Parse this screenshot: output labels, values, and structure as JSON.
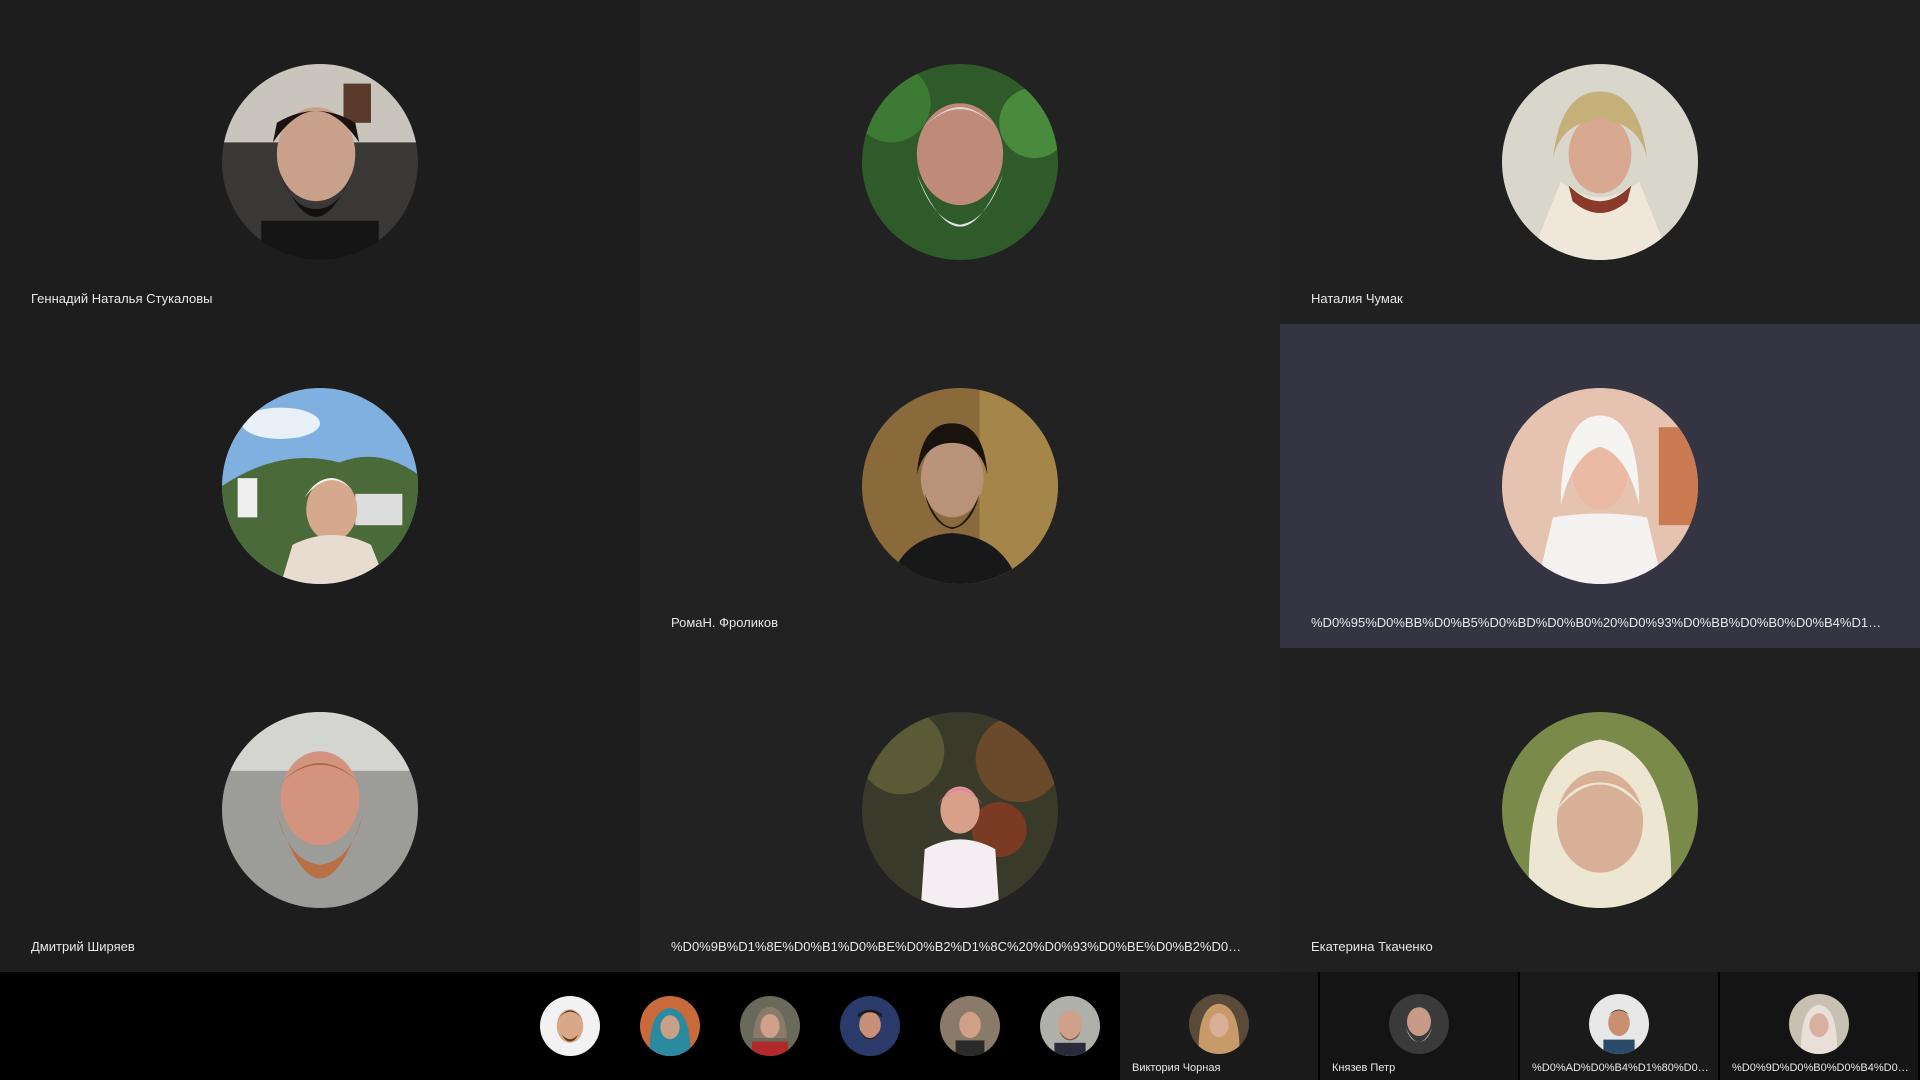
{
  "participants": [
    {
      "name": "Геннадий Наталья Стукаловы",
      "avatar": "avatar-man-bearded-dark"
    },
    {
      "name": "",
      "avatar": "avatar-man-white-beard"
    },
    {
      "name": "Наталия Чумак",
      "avatar": "avatar-woman-headscarf"
    },
    {
      "name": "",
      "avatar": "avatar-woman-outdoor"
    },
    {
      "name": "РомаН. Фроликов",
      "avatar": "avatar-man-dark-beard"
    },
    {
      "name": "%D0%95%D0%BB%D0%B5%D0%BD%D0%B0%20%D0%93%D0%BB%D0%B0%D0%B4%D1%8B%D1%89%D1%83...",
      "avatar": "avatar-woman-white-scarf",
      "speaking": true
    },
    {
      "name": "Дмитрий Ширяев",
      "avatar": "avatar-man-red-beard"
    },
    {
      "name": "%D0%9B%D1%8E%D0%B1%D0%BE%D0%B2%D1%8C%20%D0%93%D0%BE%D0%B2%D0%BE%D1%80%D0%B8...",
      "avatar": "avatar-woman-pink-scarf"
    },
    {
      "name": "Екатерина Ткаченко",
      "avatar": "avatar-woman-cream-scarf"
    }
  ],
  "strip": {
    "avatars": [
      {
        "avatar": "avatar-man-young"
      },
      {
        "avatar": "avatar-woman-blue-scarf"
      },
      {
        "avatar": "avatar-woman-older"
      },
      {
        "avatar": "avatar-man-cap"
      },
      {
        "avatar": "avatar-man-short-hair"
      },
      {
        "avatar": "avatar-man-older"
      }
    ],
    "tiles": [
      {
        "name": "Виктория Чорная",
        "avatar": "avatar-woman-patterned-scarf"
      },
      {
        "name": "Князев Петр",
        "avatar": "avatar-man-grey-beard"
      },
      {
        "name": "%D0%AD%D0%B4%D1%80%D0%B0%D0%B4%D1%8...",
        "avatar": "avatar-man-glasses"
      },
      {
        "name": "%D0%9D%D0%B0%D0%B4%D0%B5%D0%B6...",
        "avatar": "avatar-woman-light"
      }
    ]
  },
  "colors": {
    "tile_bg": "#1f1f1f",
    "speaking_bg": "#353442",
    "strip_bg": "#000000",
    "name_text": "#e8e8e8"
  }
}
